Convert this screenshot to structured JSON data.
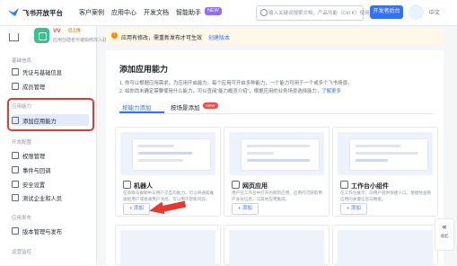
{
  "topbar": {
    "brand": "飞书开放平台",
    "nav": [
      "客户案例",
      "应用中心",
      "开发文档",
      "智能助手"
    ],
    "nav_badge": "NEW",
    "search_placeholder": "输入关键词搜索文档，产品功能（Ctrl K）使用搜索",
    "dev_console_label": "开发者后台",
    "lang": "中文"
  },
  "sidebar": {
    "app_name": "VV",
    "app_tag": "已上线",
    "app_sub": "应用创建者可编辑修改入驻",
    "sections": [
      {
        "title": "基础信息",
        "items": [
          "凭证与基础信息",
          "成员管理"
        ]
      },
      {
        "title": "应用能力",
        "items": [
          "添加应用能力"
        ]
      },
      {
        "title": "开发配置",
        "items": [
          "权限管理",
          "事件与回调",
          "安全设置",
          "测试企业和人员"
        ]
      },
      {
        "title": "应用发布",
        "items": [
          "版本管理与发布"
        ]
      },
      {
        "title": "运营监控",
        "items": []
      }
    ]
  },
  "notice": {
    "text": "应用有修改，需重新发布才可生效",
    "link": "创建版本"
  },
  "main": {
    "title": "添加应用能力",
    "desc1": "1. 你可以根据应用需求，为应用开启能力。每个应用可开启多种能力，一个能力可用于一个或多个飞书场景。",
    "desc2_prefix": "2. 如你尚未确定需要使用什么能力，可以查阅“能力概览介绍”，根据应用的业务场景选择能力，",
    "desc2_link": "了解更多",
    "tabs": [
      "按能力添加",
      "按场景添加"
    ],
    "tab_badge": "NEW",
    "cards": [
      {
        "name": "机器人",
        "desc": "在单聊与群聊中与用户交互的能力，可以将通知推送给用户或接收用户消息，可以用于智能问答。",
        "add_label": "+ 添加"
      },
      {
        "name": "网页应用",
        "desc": "用户在工作台中打开的网页应用，应用内可获取用户身份信息，与其他应用集成。",
        "add_label": "+ 添加"
      },
      {
        "name": "工作台小组件",
        "desc": "在工作台展示，向用户提供快捷入口，便捷地查看应用的关键信息与数据。",
        "add_label": "+ 添加"
      }
    ]
  },
  "float": {
    "label": "收起",
    "icon": "double-chevron-left-icon"
  }
}
